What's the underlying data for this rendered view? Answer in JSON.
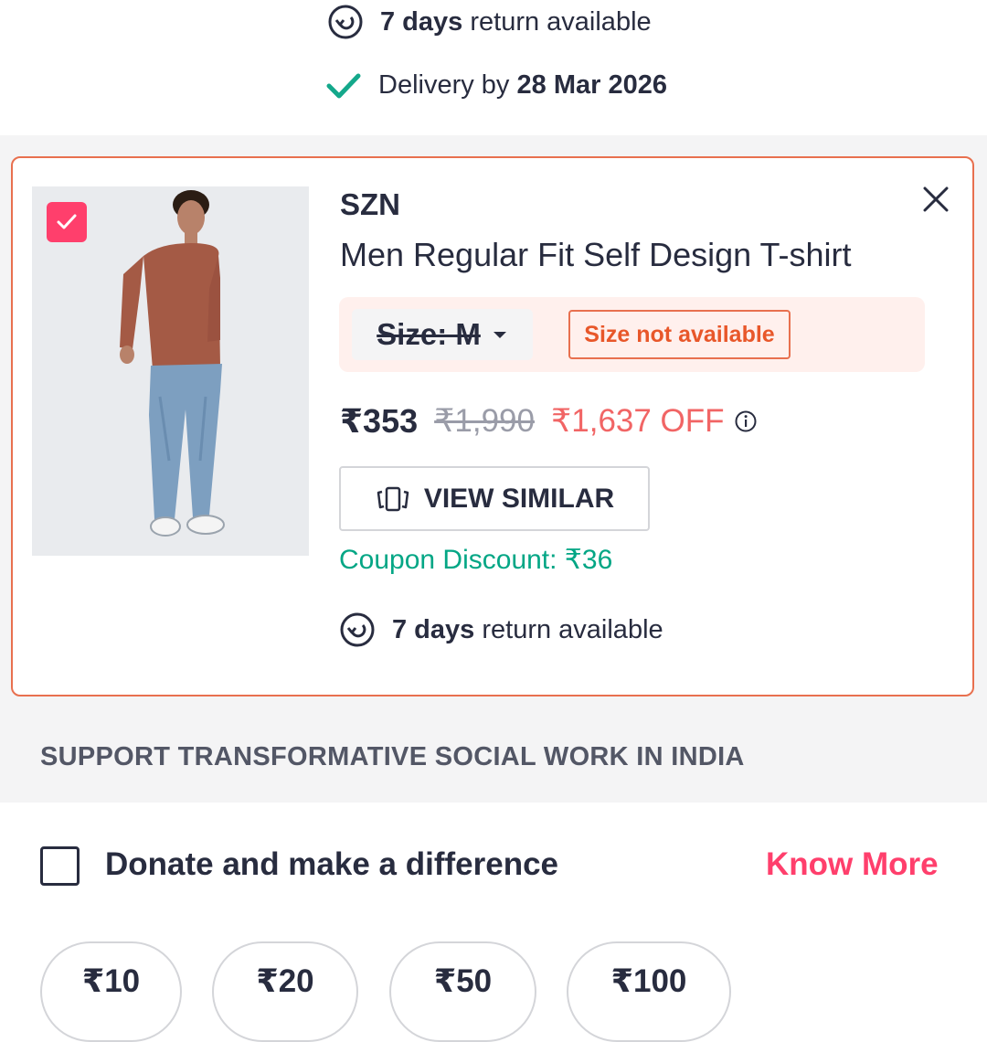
{
  "top_section": {
    "return_bold": "7 days",
    "return_text": " return available",
    "delivery_text": "Delivery by ",
    "delivery_date": "28 Mar 2026"
  },
  "item": {
    "brand": "SZN",
    "title": "Men Regular Fit Self Design T-shirt",
    "selected": true,
    "size_label": "Size: M",
    "size_status": "Size not available",
    "price": "₹353",
    "mrp": "₹1,990",
    "discount": "₹1,637 OFF",
    "view_similar_label": "VIEW SIMILAR",
    "coupon_discount": "Coupon Discount: ₹36",
    "return_bold": "7 days",
    "return_text": " return available"
  },
  "donation": {
    "section_title": "SUPPORT TRANSFORMATIVE SOCIAL WORK IN INDIA",
    "checkbox_label": "Donate and make a difference",
    "know_more_label": "Know More",
    "amounts": [
      "₹10",
      "₹20",
      "₹50",
      "₹100"
    ]
  },
  "colors": {
    "accent_pink": "#ff3f6c",
    "coupon_green": "#03a685",
    "warning_orange": "#e8704f",
    "discount_red": "#f16565",
    "check_green": "#14a88b"
  },
  "icons": {
    "return": "return-arrow-icon",
    "delivery": "checkmark-icon",
    "close": "close-icon",
    "dropdown": "caret-down-icon",
    "info": "info-icon",
    "similar": "view-similar-icon"
  }
}
